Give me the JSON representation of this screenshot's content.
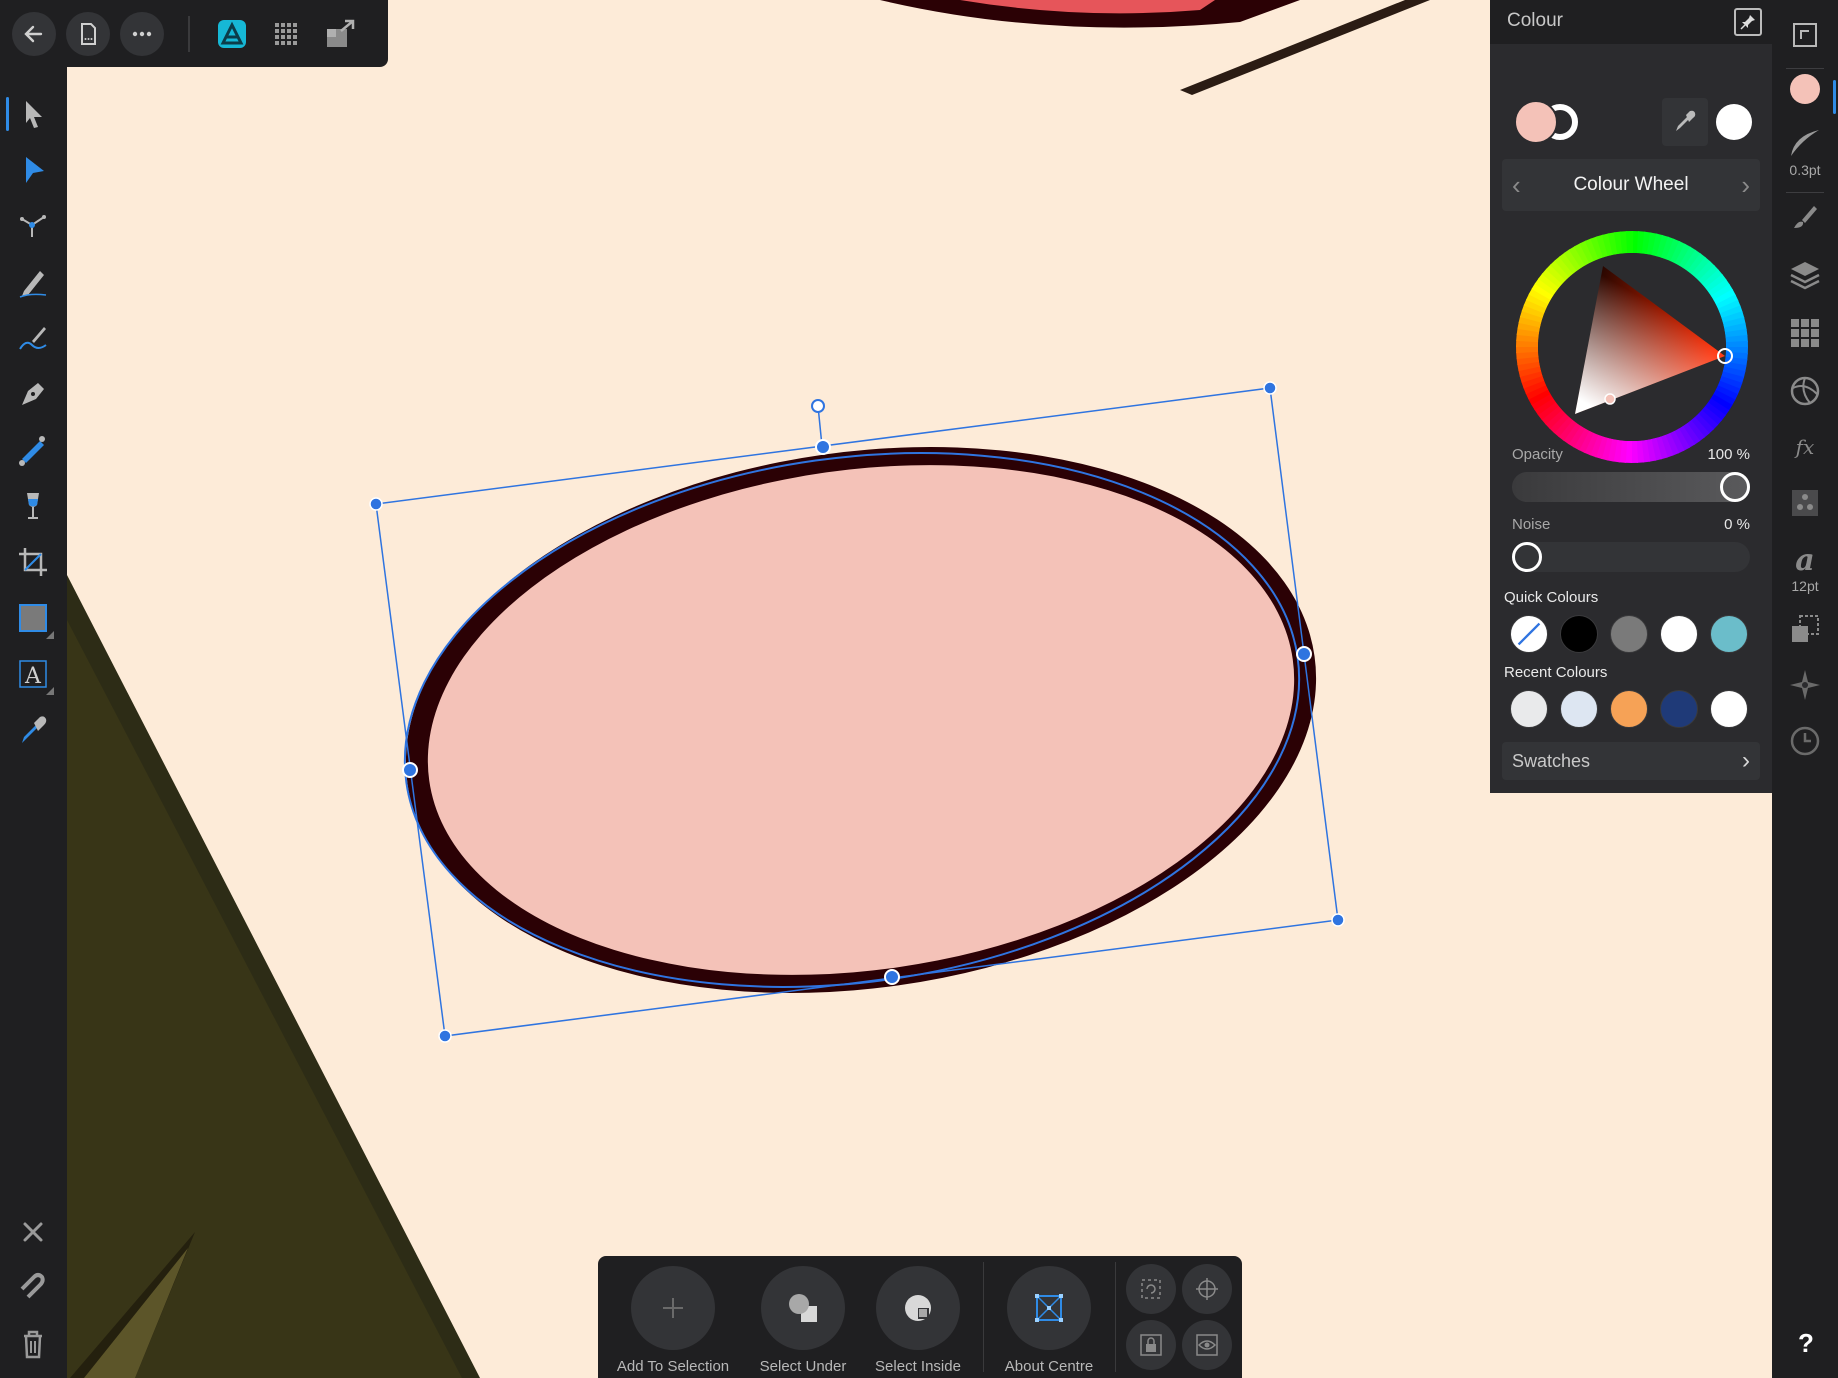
{
  "colour_panel": {
    "title": "Colour",
    "mode_label": "Colour Wheel",
    "fill_colour": "#f4c2b8",
    "stroke_colour": "#ffffff",
    "picked_colour": "#ffffff",
    "opacity_label": "Opacity",
    "opacity_value": "100 %",
    "opacity_level": 1.0,
    "noise_label": "Noise",
    "noise_value": "0 %",
    "noise_level": 0.0,
    "quick_colours_label": "Quick Colours",
    "quick_colours": [
      "none",
      "#000000",
      "#7a7a7a",
      "#ffffff",
      "#6bbdca"
    ],
    "recent_colours_label": "Recent Colours",
    "recent_colours": [
      "#e9eaeb",
      "#dde6f2",
      "#f6a256",
      "#1f3a78",
      "#ffffff"
    ],
    "swatches_label": "Swatches"
  },
  "right_strip": {
    "stroke_width_label": "0.3pt",
    "text_size_label": "12pt"
  },
  "context_toolbar": {
    "add_to_selection": "Add To Selection",
    "select_under": "Select Under",
    "select_inside": "Select Inside",
    "about_centre": "About Centre"
  },
  "help_label": "?",
  "accent_colour": "#2f8be6",
  "canvas": {
    "background": "#fdebd8",
    "shape_fill": "#f4c2b8",
    "shape_stroke": "#2b0105"
  }
}
